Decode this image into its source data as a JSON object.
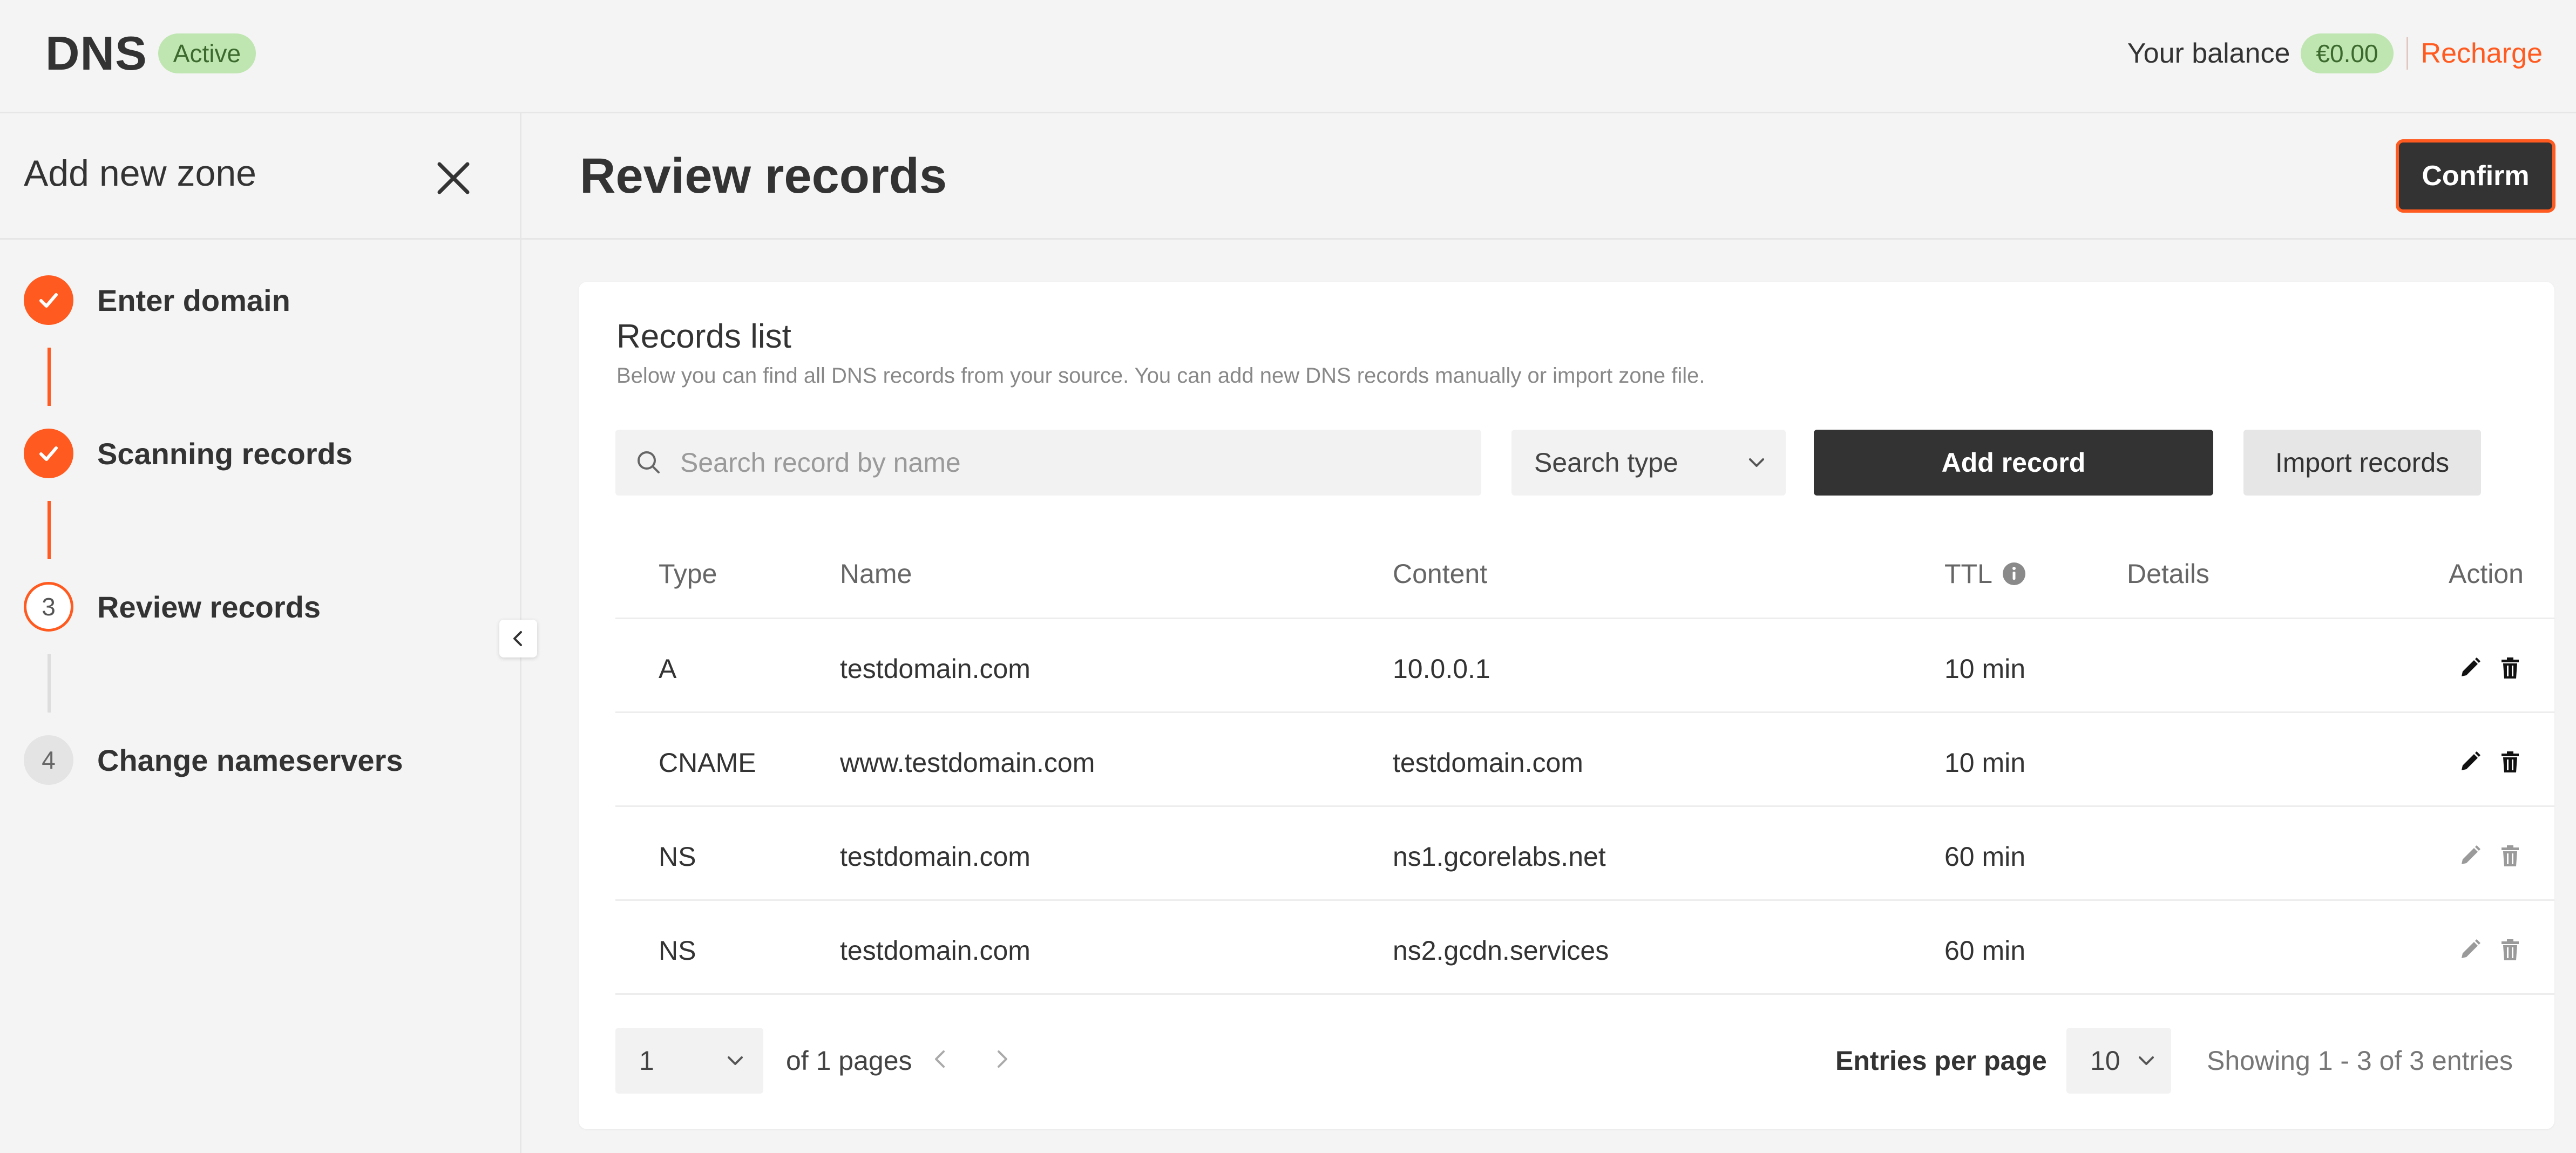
{
  "header": {
    "brand": "DNS",
    "status_badge": "Active",
    "balance_label": "Your balance",
    "balance_amount": "€0.00",
    "recharge_label": "Recharge"
  },
  "sidebar": {
    "title": "Add new zone",
    "steps": [
      {
        "label": "Enter domain",
        "state": "done"
      },
      {
        "label": "Scanning records",
        "state": "done"
      },
      {
        "label": "Review records",
        "number": "3",
        "state": "current"
      },
      {
        "label": "Change nameservers",
        "number": "4",
        "state": "future"
      }
    ]
  },
  "main": {
    "title": "Review records",
    "confirm_label": "Confirm"
  },
  "records": {
    "title": "Records list",
    "subtitle": "Below you can find all DNS records from your source. You can add new DNS records manually or import zone file.",
    "search_placeholder": "Search record by name",
    "type_select": "Search type",
    "add_label": "Add record",
    "import_label": "Import records",
    "columns": {
      "type": "Type",
      "name": "Name",
      "content": "Content",
      "ttl": "TTL",
      "details": "Details",
      "action": "Action"
    },
    "rows": [
      {
        "type": "A",
        "name": "testdomain.com",
        "content": "10.0.0.1",
        "ttl": "10 min",
        "editable": true
      },
      {
        "type": "CNAME",
        "name": "www.testdomain.com",
        "content": "testdomain.com",
        "ttl": "10 min",
        "editable": true
      },
      {
        "type": "NS",
        "name": "testdomain.com",
        "content": "ns1.gcorelabs.net",
        "ttl": "60 min",
        "editable": false
      },
      {
        "type": "NS",
        "name": "testdomain.com",
        "content": "ns2.gcdn.services",
        "ttl": "60 min",
        "editable": false
      }
    ],
    "pagination": {
      "page": "1",
      "of_pages": "of 1 pages",
      "entries_label": "Entries per page",
      "entries_value": "10",
      "showing": "Showing 1 - 3 of 3 entries"
    }
  },
  "colors": {
    "accent": "#ff5a1f",
    "dark": "#333333",
    "badge_bg": "#bfe6b1",
    "badge_text": "#3c6a2e"
  }
}
